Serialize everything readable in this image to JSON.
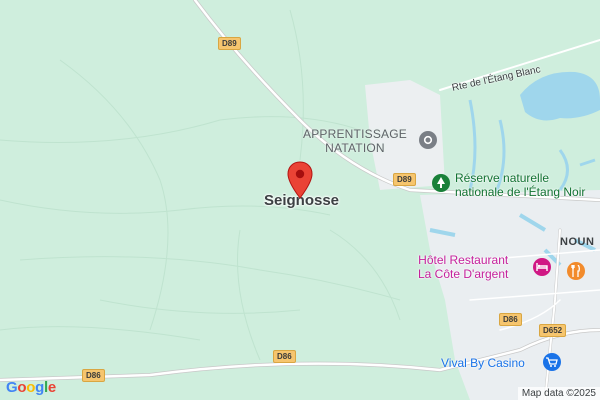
{
  "map": {
    "town_label": "Seignosse",
    "pin_icon": "map-pin-icon",
    "pois": {
      "apprentissage_line1": "APPRENTISSAGE",
      "apprentissage_line2": "NATATION",
      "reserve_line1": "Réserve naturelle",
      "reserve_line2": "nationale de l'Étang Noir",
      "hotel_line1": "Hôtel Restaurant",
      "hotel_line2": "La Côte D'argent",
      "vival": "Vival By Casino"
    },
    "road_name": "Rte de l'Étang Blanc",
    "neighbor_town": "NOUN",
    "shields": {
      "d89_top": "D89",
      "d89_mid": "D89",
      "d86_right": "D86",
      "d86_mid": "D86",
      "d86_left": "D86",
      "d652": "D652"
    },
    "icons": {
      "poi_grey": "place-icon",
      "tree": "park-icon",
      "restaurant": "restaurant-icon",
      "hotel": "hotel-icon",
      "shop": "shopping-cart-icon"
    },
    "colors": {
      "forest": "#cfeedd",
      "water": "#9fd6ec",
      "road_major": "#ffffff",
      "shield": "#f6c56e",
      "pin": "#ea4335"
    }
  },
  "footer": {
    "logo_letters": [
      "G",
      "o",
      "o",
      "g",
      "l",
      "e"
    ],
    "attribution": "Map data ©2025"
  }
}
